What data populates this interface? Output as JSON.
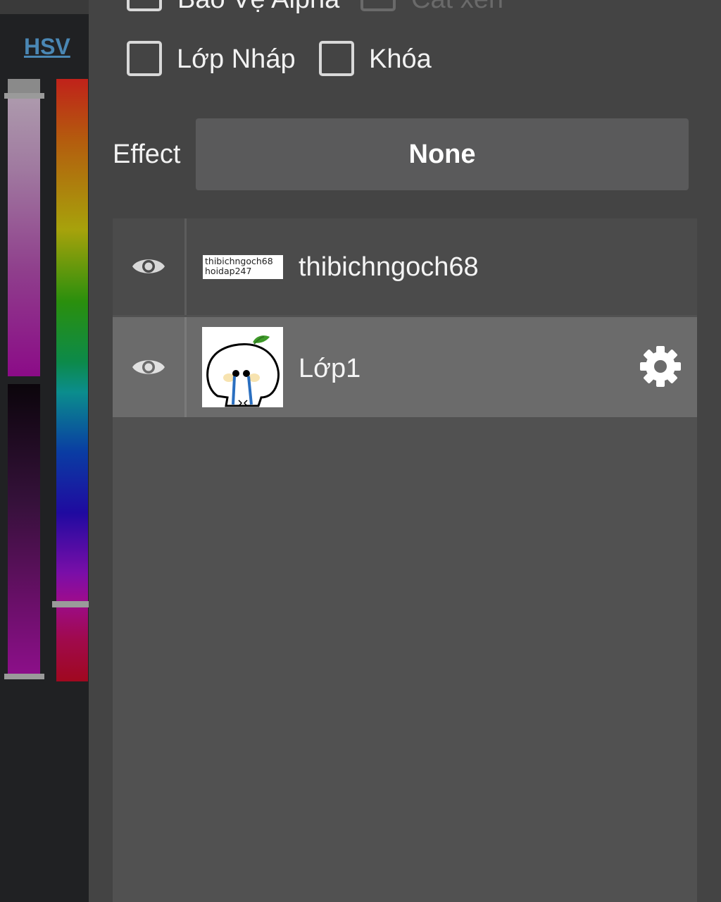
{
  "color_panel": {
    "mode_tab": "HSV",
    "hue_bar_gradient": [
      "#c0221a",
      "#a7a20c",
      "#2a8f0d",
      "#0b8d8d",
      "#0a3ca3",
      "#7a0ea8",
      "#a0081f"
    ],
    "selected_color": "#8e0f8b"
  },
  "layer_options": {
    "checkboxes": [
      {
        "label": "Bảo Vệ Alpha",
        "checked": false,
        "enabled": true
      },
      {
        "label": "Cắt xén",
        "checked": false,
        "enabled": false
      },
      {
        "label": "Lớp Nháp",
        "checked": false,
        "enabled": true
      },
      {
        "label": "Khóa",
        "checked": false,
        "enabled": true
      }
    ],
    "effect": {
      "label": "Effect",
      "value": "None"
    }
  },
  "layers": [
    {
      "name": "thibichngoch68",
      "visible": true,
      "selected": false,
      "thumbnail_text": [
        "thibichngoch68",
        "hoidap247"
      ]
    },
    {
      "name": "Lớp1",
      "visible": true,
      "selected": true
    }
  ],
  "icons": {
    "visibility": "eye-icon",
    "layer_settings": "gear-icon"
  }
}
